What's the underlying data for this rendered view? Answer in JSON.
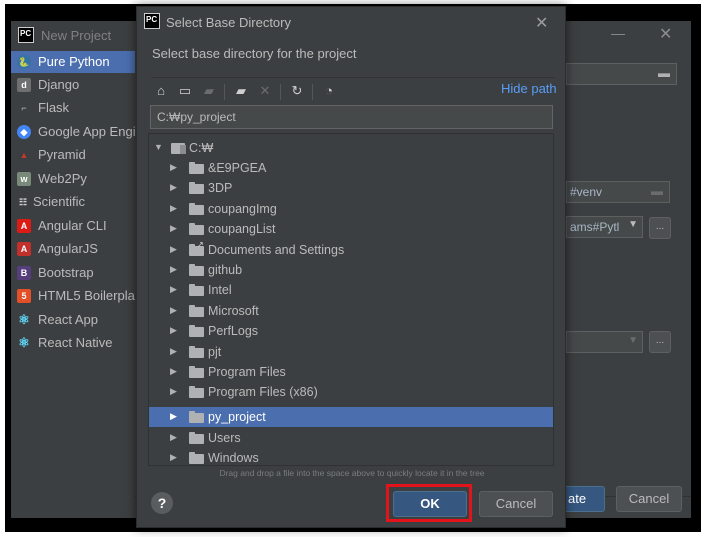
{
  "background_window": {
    "title": "New Project",
    "minimize_glyph": "—",
    "close_glyph": "✕",
    "sidebar_items": [
      {
        "label": "Pure Python",
        "icon": "python-icon",
        "selected": true
      },
      {
        "label": "Django",
        "icon": "django-icon"
      },
      {
        "label": "Flask",
        "icon": "flask-icon"
      },
      {
        "label": "Google App Engine",
        "icon": "google-app-engine-icon"
      },
      {
        "label": "Pyramid",
        "icon": "pyramid-icon"
      },
      {
        "label": "Web2Py",
        "icon": "web2py-icon"
      },
      {
        "label": "Scientific",
        "icon": "scientific-icon"
      },
      {
        "label": "Angular CLI",
        "icon": "angular-icon"
      },
      {
        "label": "AngularJS",
        "icon": "angularjs-icon"
      },
      {
        "label": "Bootstrap",
        "icon": "bootstrap-icon"
      },
      {
        "label": "HTML5 Boilerplate",
        "icon": "html5-icon"
      },
      {
        "label": "React App",
        "icon": "react-icon"
      },
      {
        "label": "React Native",
        "icon": "react-native-icon"
      }
    ],
    "venv_field_value": "#venv",
    "interpreter_field_value": "ams#Pytl",
    "ellipsis": "...",
    "create_button_partial": "ate",
    "cancel_label": "Cancel"
  },
  "dialog": {
    "title": "Select Base Directory",
    "close_glyph": "✕",
    "description": "Select base directory for the project",
    "hide_path_label": "Hide path",
    "path_value": "C:\\py_project",
    "path_display": "C:₩py_project",
    "tree": {
      "root": "C:₩",
      "children": [
        {
          "name": "&E9PGEA"
        },
        {
          "name": "3DP"
        },
        {
          "name": "coupangImg"
        },
        {
          "name": "coupangList"
        },
        {
          "name": "Documents and Settings",
          "link": true
        },
        {
          "name": "github"
        },
        {
          "name": "Intel"
        },
        {
          "name": "Microsoft"
        },
        {
          "name": "PerfLogs"
        },
        {
          "name": "pjt"
        },
        {
          "name": "Program Files"
        },
        {
          "name": "Program Files (x86)"
        },
        {
          "name": "py_project",
          "selected": true
        },
        {
          "name": "Users"
        },
        {
          "name": "Windows"
        }
      ]
    },
    "hint": "Drag and drop a file into the space above to quickly locate it in the tree",
    "help_glyph": "?",
    "ok_label": "OK",
    "cancel_label": "Cancel"
  },
  "colors": {
    "background": "#3c3f41",
    "selection": "#4b6eaf",
    "link": "#589df6",
    "ok_button": "#365880",
    "highlight": "#e3131b"
  }
}
